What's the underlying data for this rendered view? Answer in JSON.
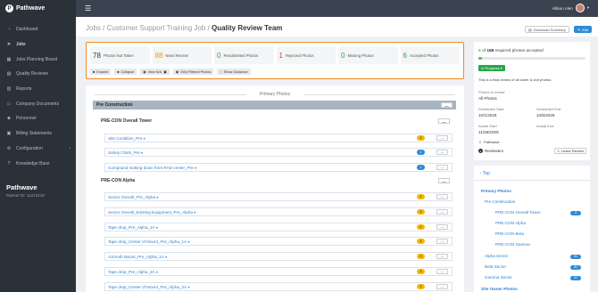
{
  "app": {
    "name": "Pathwave",
    "logo_letter": "P"
  },
  "sidebar": {
    "items": [
      {
        "label": "Dashboard",
        "icon": "dashboard-icon",
        "glyph": "◔"
      },
      {
        "label": "Jobs",
        "icon": "tools-icon",
        "glyph": "✕",
        "active": true
      },
      {
        "label": "Jobs Planning Board",
        "icon": "grid-icon",
        "glyph": "▦"
      },
      {
        "label": "Quality Reviews",
        "icon": "checklist-icon",
        "glyph": "▤"
      },
      {
        "label": "Reports",
        "icon": "reports-icon",
        "glyph": "▥"
      },
      {
        "label": "Company Documents",
        "icon": "folder-icon",
        "glyph": "▭"
      },
      {
        "label": "Personnel",
        "icon": "people-icon",
        "glyph": "☻"
      },
      {
        "label": "Billing Statements",
        "icon": "billing-icon",
        "glyph": "▣"
      },
      {
        "label": "Configuration",
        "icon": "gear-icon",
        "glyph": "⚙",
        "chevron": "›"
      },
      {
        "label": "Knowledge Base",
        "icon": "help-icon",
        "glyph": "?"
      }
    ],
    "tenant_name": "Pathwave",
    "tenant_id": "Partner ID: 11213219"
  },
  "topbar": {
    "user_name": "Allison Alen",
    "menu_glyph": "☰",
    "caret": "▾"
  },
  "header": {
    "breadcrumb_1": "Jobs",
    "sep": " / ",
    "breadcrumb_2": "Customer Support Training Job",
    "title": "Quality Review Team",
    "download_label": "Download Summary",
    "edit_label": "Edit"
  },
  "stats": [
    {
      "value": "78",
      "label": "Photos Not Taken",
      "color": "#333333"
    },
    {
      "value": "88",
      "label": "Need Review",
      "color": "#e0a800"
    },
    {
      "value": "0",
      "label": "Resubmitted Photos",
      "color": "#28a745"
    },
    {
      "value": "1",
      "label": "Rejected Photos",
      "color": "#dc3545"
    },
    {
      "value": "0",
      "label": "Missing Photos",
      "color": "#28a745"
    },
    {
      "value": "6",
      "label": "Accepted Photos",
      "color": "#28a745"
    }
  ],
  "actions": {
    "expand": "Expand",
    "collapse": "Collapse",
    "view_na": "View N/A",
    "filtered": "Only Filtered Photos",
    "guidance": "Show Guidance"
  },
  "photos": {
    "section_title": "Primary Photos",
    "phase_title": "Pre Construction",
    "group_1": "PRE-CON Overall Tower",
    "group_2": "PRE-CON Alpha",
    "rows": [
      {
        "label": "Site Condition_Pre",
        "badge": "8",
        "badge_color": "warn"
      },
      {
        "label": "Safety Climb_Pre",
        "badge": "1",
        "badge_color": "info"
      },
      {
        "label": "Compound looking down from RAD center_Pre",
        "badge": "1",
        "badge_color": "info"
      },
      {
        "label": "Sector Overall_Pre_Alpha",
        "badge": "8",
        "badge_color": "warn"
      },
      {
        "label": "Sector Overall_Existing Equipment_Pre_Alpha",
        "badge": "8",
        "badge_color": "warn"
      },
      {
        "label": "Tape drop_Pre_Alpha_1A",
        "badge": "8",
        "badge_color": "warn"
      },
      {
        "label": "Tape drop_Center of Mount_Pre_Alpha_1A",
        "badge": "8",
        "badge_color": "warn"
      },
      {
        "label": "Azimuth Mount_Pre_Alpha_1A",
        "badge": "8",
        "badge_color": "warn"
      },
      {
        "label": "Tape drop_Pre_Alpha_2A",
        "badge": "8",
        "badge_color": "warn"
      },
      {
        "label": "Tape drop_Center of Mount_Pre_Alpha_2A",
        "badge": "8",
        "badge_color": "warn"
      }
    ]
  },
  "summary": {
    "accepted_count": "5",
    "total_required": "168",
    "accepted_text": "required photos accepted",
    "accepted_fraction": 0.03,
    "status": "In Progress",
    "note": "This is a final review of all tower & civil photos.",
    "photos_to_review_label": "Photos to review",
    "photos_to_review_value": "All Photos",
    "scheduled_start_label": "Scheduled Start",
    "scheduled_start": "10/1/2025",
    "scheduled_end_label": "Scheduled End",
    "scheduled_end": "10/8/2025",
    "actual_start_label": "Actual Start",
    "actual_start": "11/28/2025",
    "actual_end_label": "Actual End",
    "actual_end": "",
    "assignee": "Pathwave",
    "reviewers_count": "3",
    "reviewers_label": "Reviewers",
    "leave_review": "Leave Review"
  },
  "toc": {
    "top": "↑ Top",
    "items": [
      {
        "label": "Primary Photos",
        "bold": true,
        "count": ""
      },
      {
        "label": "Pre Construction",
        "bold": false,
        "count": ""
      },
      {
        "label": "PRE-CON Overall Tower",
        "bold": false,
        "count": "3"
      },
      {
        "label": "PRE-CON Alpha",
        "bold": false,
        "count": ""
      },
      {
        "label": "PRE-CON Beta",
        "bold": false,
        "count": ""
      },
      {
        "label": "PRE-CON Gamma",
        "bold": false,
        "count": ""
      },
      {
        "label": "Alpha Sector",
        "bold": false,
        "count": "31"
      },
      {
        "label": "Beta Sector",
        "bold": false,
        "count": "31"
      },
      {
        "label": "Gamma Sector",
        "bold": false,
        "count": "31"
      },
      {
        "label": "Site Owner Photos",
        "bold": true,
        "count": ""
      }
    ]
  }
}
